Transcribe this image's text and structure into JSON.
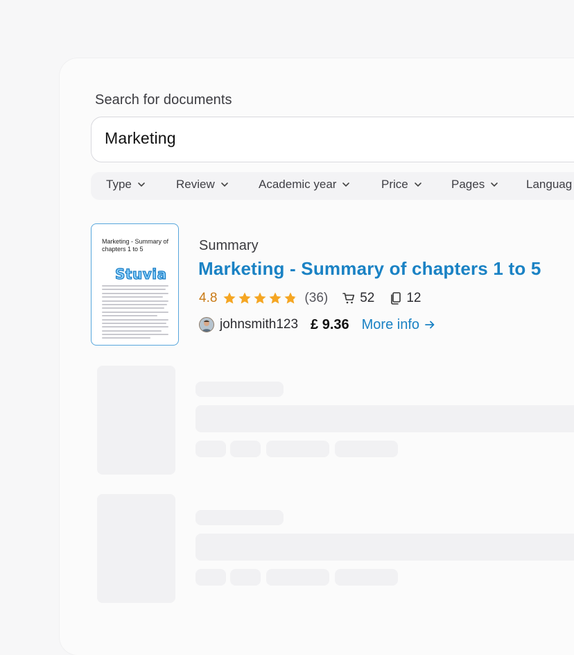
{
  "search": {
    "label": "Search for documents",
    "value": "Marketing"
  },
  "filters": [
    {
      "label": "Type"
    },
    {
      "label": "Review"
    },
    {
      "label": "Academic year"
    },
    {
      "label": "Price"
    },
    {
      "label": "Pages"
    },
    {
      "label": "Languag"
    }
  ],
  "result": {
    "thumbnail_title": "Marketing - Summary of chapters 1 to 5",
    "thumbnail_logo": "Stuvia",
    "type": "Summary",
    "title": "Marketing - Summary of chapters 1 to 5",
    "rating": "4.8",
    "rating_value": 4.8,
    "rating_max": 5,
    "review_count": "(36)",
    "sales": "52",
    "pages": "12",
    "author": "johnsmith123",
    "price": "£ 9.36",
    "more_info": "More info"
  },
  "icons": {
    "cart": "cart-icon",
    "pages": "pages-icon",
    "arrow": "arrow-right-icon",
    "chevron": "chevron-down-icon",
    "star": "star-icon"
  },
  "colors": {
    "accent": "#1a82c4",
    "rating": "#c97a16",
    "star": "#f5a623",
    "thumb_border": "#57a6dc"
  }
}
